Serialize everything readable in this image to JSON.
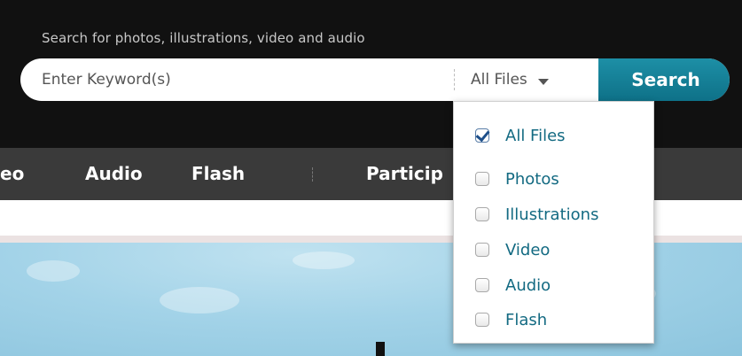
{
  "search": {
    "hint": "Search for photos, illustrations, video and audio",
    "placeholder": "Enter Keyword(s)",
    "filetype_selected": "All Files",
    "button_label": "Search"
  },
  "nav": {
    "items": [
      {
        "label": "eo"
      },
      {
        "label": "Audio"
      },
      {
        "label": "Flash"
      },
      {
        "label": "Particip"
      }
    ]
  },
  "dropdown": {
    "options": [
      {
        "label": "All Files",
        "checked": true
      },
      {
        "label": "Photos",
        "checked": false
      },
      {
        "label": "Illustrations",
        "checked": false
      },
      {
        "label": "Video",
        "checked": false
      },
      {
        "label": "Audio",
        "checked": false
      },
      {
        "label": "Flash",
        "checked": false
      }
    ]
  },
  "colors": {
    "search_button": "#1285a0",
    "dropdown_text": "#136a82",
    "nav_bg": "#3a3a3a",
    "header_bg": "#111111"
  }
}
